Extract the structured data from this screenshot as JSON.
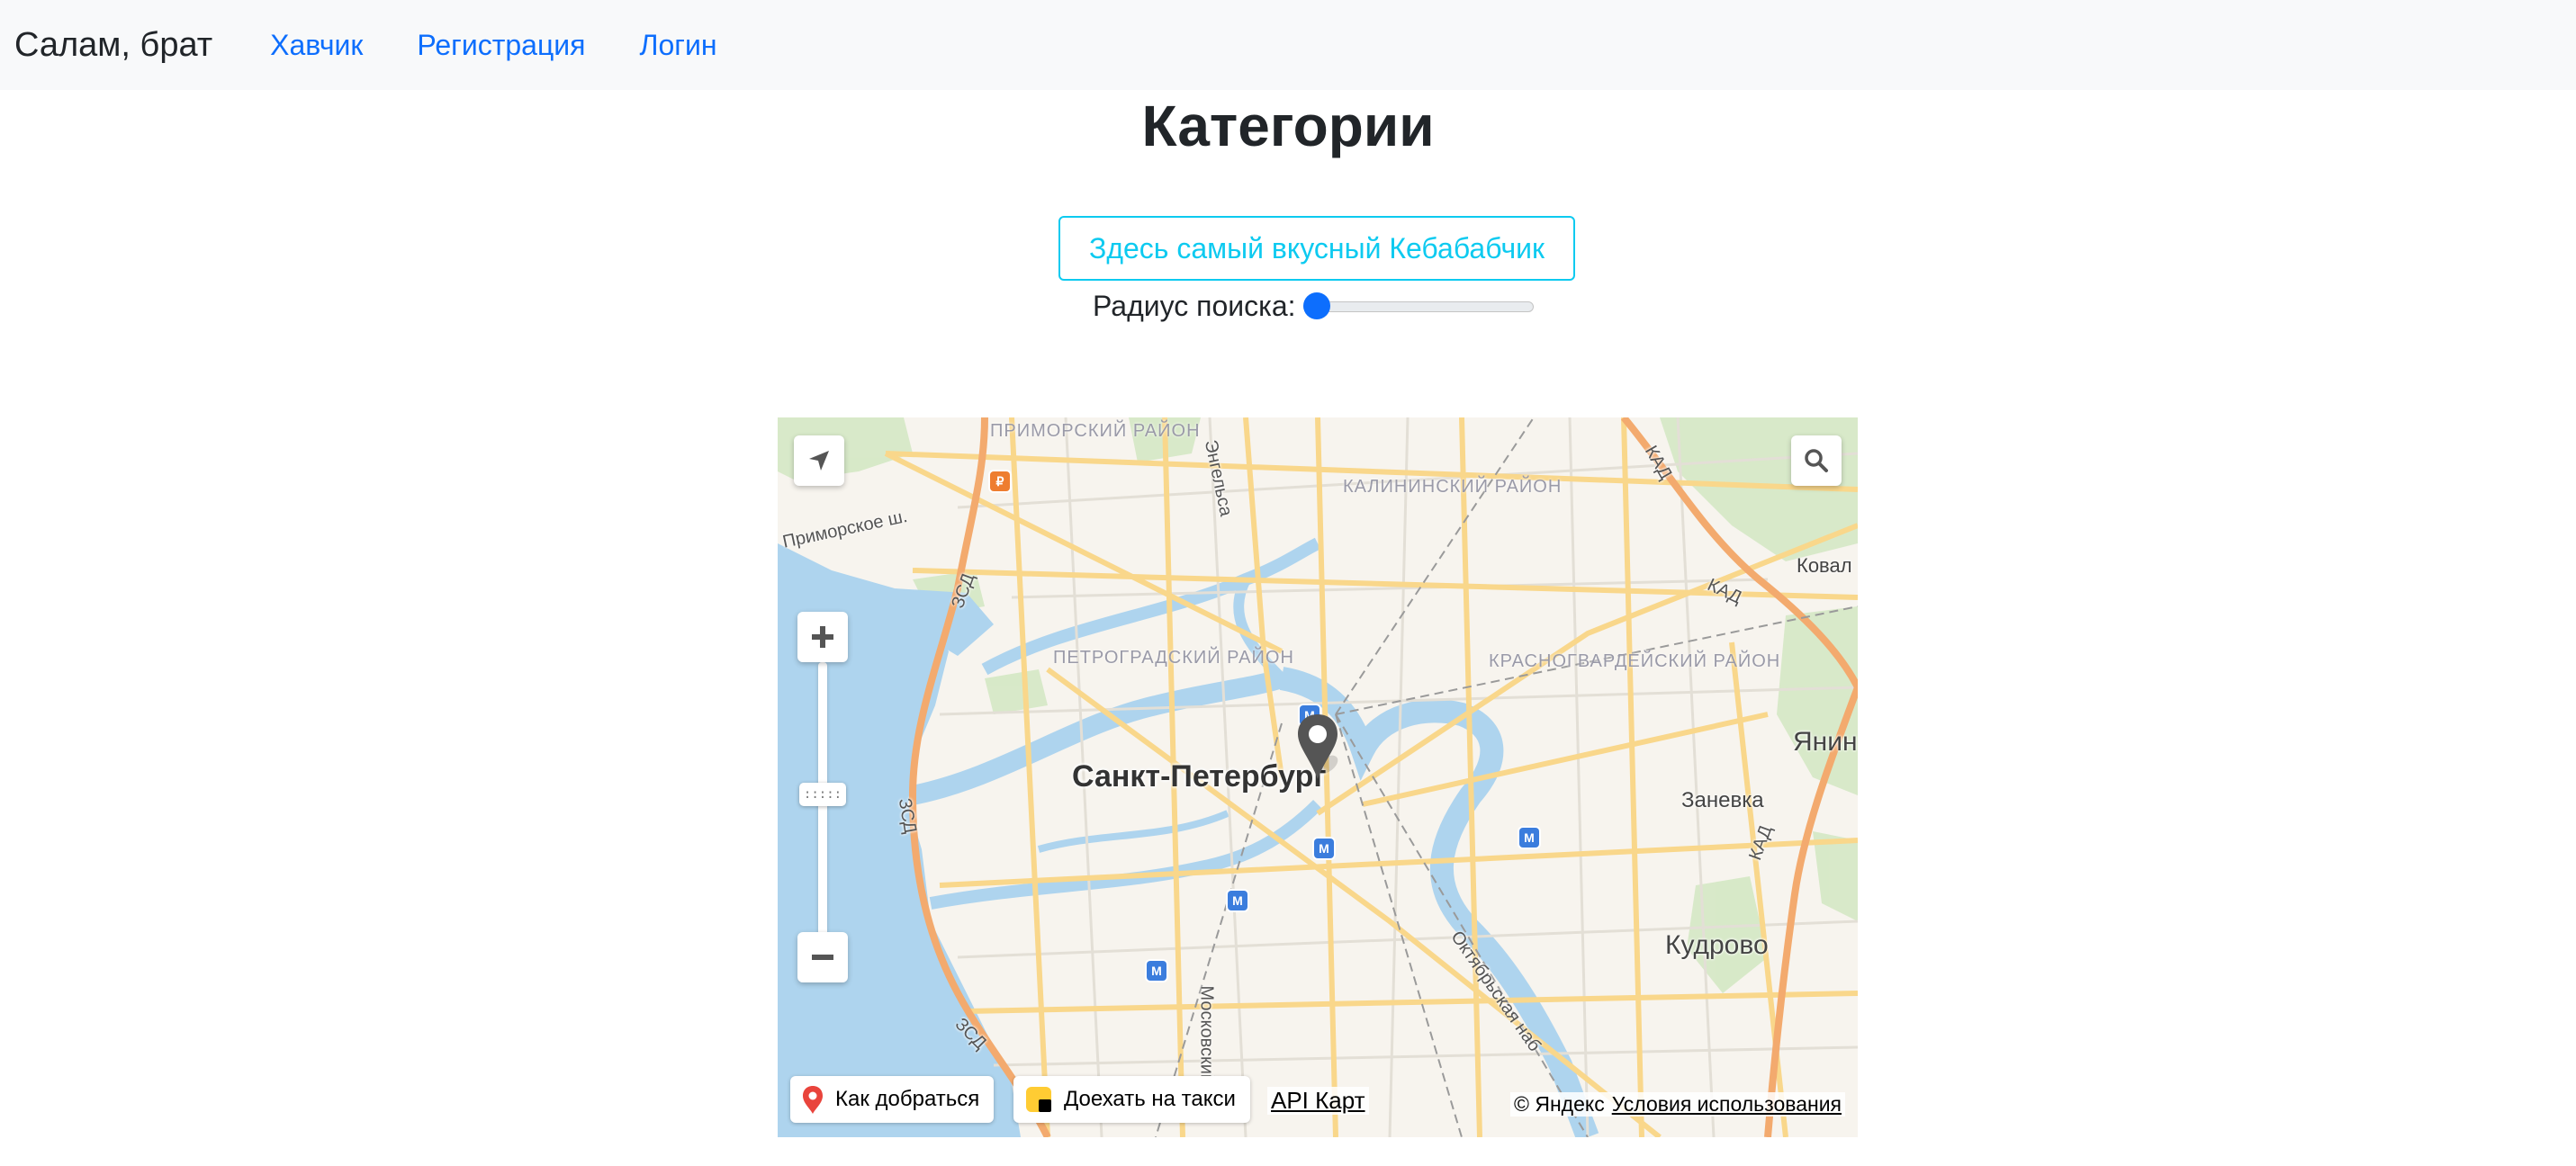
{
  "navbar": {
    "brand": "Салам, брат",
    "links": [
      "Хавчик",
      "Регистрация",
      "Логин"
    ]
  },
  "main": {
    "title": "Категории",
    "promo_button": "Здесь самый вкусный Кебабабчик",
    "radius_label": "Радиус поиска:",
    "radius_value": 0
  },
  "map": {
    "city": "Санкт-Петербург",
    "districts": [
      "ПРИМОРСКИЙ РАЙОН",
      "КАЛИНИНСКИЙ РАЙОН",
      "ПЕТРОГРАДСКИЙ РАЙОН",
      "КРАСНОГВАРДЕЙСКИЙ РАЙОН"
    ],
    "places": [
      "Янин",
      "Заневка",
      "Кудрово",
      "Ковал"
    ],
    "roads": [
      "Приморское ш.",
      "Энгельса",
      "ЗСД",
      "КАД",
      "Московский",
      "Октябрьская наб"
    ],
    "controls": {
      "route_label": "Как добраться",
      "taxi_label": "Доехать на такси",
      "api_link": "API Карт",
      "copyright": "© Яндекс",
      "terms": "Условия использования",
      "zoom_handle": ":::::"
    },
    "colors": {
      "water": "#aed4ee",
      "land": "#f7f4ee",
      "park": "#d4e8c4",
      "major_road": "#f9d78b",
      "highway": "#f3aa6e",
      "metro": "#3b7ddd"
    }
  }
}
